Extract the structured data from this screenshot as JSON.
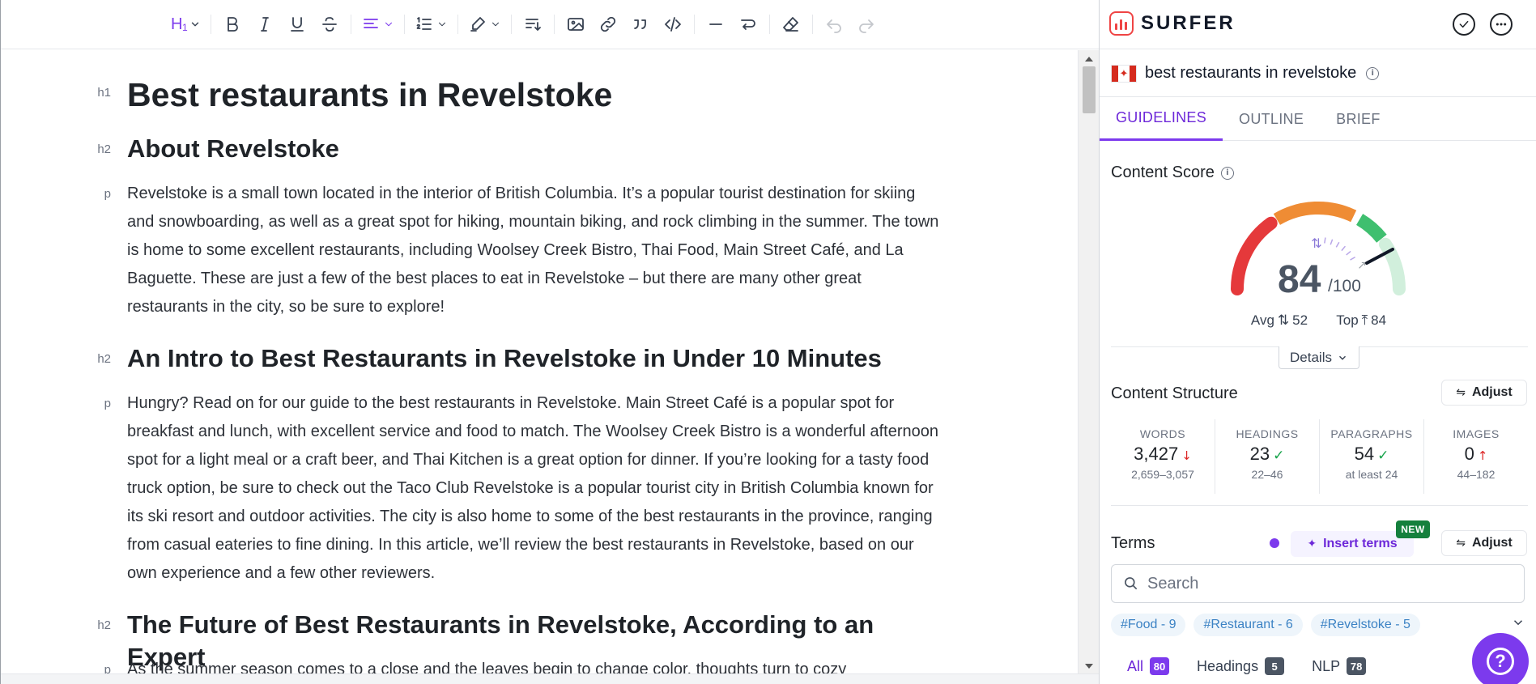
{
  "document": {
    "blocks": [
      {
        "tag": "h1",
        "text": "Best restaurants in Revelstoke"
      },
      {
        "tag": "h2",
        "text": "About Revelstoke"
      },
      {
        "tag": "p",
        "text": "Revelstoke is a small town located in the interior of British Columbia. It’s a popular tourist destination for skiing and snowboarding, as well as a great spot for hiking, mountain biking, and rock climbing in the summer. The town is home to some excellent restaurants, including Woolsey Creek Bistro, Thai Food, Main Street Café, and La Baguette. These are just a few of the best places to eat in Revelstoke – but there are many other great restaurants in the city, so be sure to explore!"
      },
      {
        "tag": "h2",
        "text": "An Intro to Best Restaurants in Revelstoke in Under 10 Minutes"
      },
      {
        "tag": "p",
        "text": "Hungry? Read on for our guide to the best restaurants in Revelstoke. Main Street Café is a popular spot for breakfast and lunch, with excellent service and food to match. The Woolsey Creek Bistro is a wonderful afternoon spot for a light meal or a craft beer, and Thai Kitchen is a great option for dinner. If you’re looking for a tasty food truck option, be sure to check out the Taco Club Revelstoke is a popular tourist city in British Columbia known for its ski resort and outdoor activities. The city is also home to some of the best restaurants in the province, ranging from casual eateries to fine dining. In this article, we’ll review the best restaurants in Revelstoke, based on our own experience and a few other reviewers."
      },
      {
        "tag": "h2",
        "text": "The Future of Best Restaurants in Revelstoke, According to an Expert"
      },
      {
        "tag": "p",
        "text": "As the summer season comes to a close and the leaves begin to change color, thoughts turn to cozy"
      }
    ]
  },
  "toolbar": {
    "heading_label": "H",
    "heading_level": "1"
  },
  "panel": {
    "brand": "SURFER",
    "keyword": "best restaurants in revelstoke",
    "tabs": [
      "GUIDELINES",
      "OUTLINE",
      "BRIEF"
    ],
    "content_score": {
      "title": "Content Score",
      "score": "84",
      "max": "/100",
      "avg_label": "Avg",
      "avg": "52",
      "top_label": "Top",
      "top": "84",
      "details": "Details"
    },
    "structure": {
      "title": "Content Structure",
      "adjust": "Adjust",
      "stats": [
        {
          "label": "WORDS",
          "value": "3,427",
          "trend": "down",
          "range": "2,659–3,057"
        },
        {
          "label": "HEADINGS",
          "value": "23",
          "trend": "ok",
          "range": "22–46"
        },
        {
          "label": "PARAGRAPHS",
          "value": "54",
          "trend": "ok",
          "range": "at least 24"
        },
        {
          "label": "IMAGES",
          "value": "0",
          "trend": "up",
          "range": "44–182"
        }
      ]
    },
    "terms": {
      "title": "Terms",
      "insert": "Insert terms",
      "new_badge": "NEW",
      "adjust": "Adjust",
      "search_placeholder": "Search",
      "chips": [
        "#Food - 9",
        "#Restaurant - 6",
        "#Revelstoke - 5"
      ],
      "filters": [
        {
          "label": "All",
          "count": "80"
        },
        {
          "label": "Headings",
          "count": "5"
        },
        {
          "label": "NLP",
          "count": "78"
        }
      ]
    }
  },
  "colors": {
    "accent": "#7c3aed",
    "gauge_red": "#e5393b",
    "gauge_orange": "#ef8c34",
    "gauge_green": "#3fbf6f",
    "gauge_light_green": "#d1efdc"
  }
}
